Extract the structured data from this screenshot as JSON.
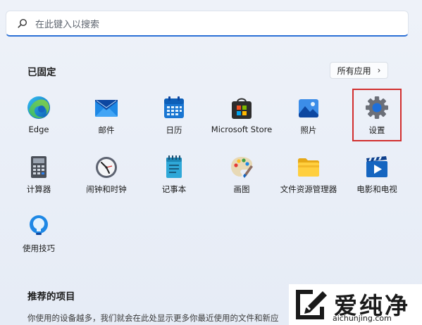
{
  "search": {
    "placeholder": "在此键入以搜索"
  },
  "pinned": {
    "title": "已固定",
    "all_apps_label": "所有应用",
    "apps": [
      {
        "label": "Edge",
        "icon": "edge-icon"
      },
      {
        "label": "邮件",
        "icon": "mail-icon"
      },
      {
        "label": "日历",
        "icon": "calendar-icon"
      },
      {
        "label": "Microsoft Store",
        "icon": "store-icon"
      },
      {
        "label": "照片",
        "icon": "photos-icon"
      },
      {
        "label": "设置",
        "icon": "settings-gear-icon"
      },
      {
        "label": "计算器",
        "icon": "calculator-icon"
      },
      {
        "label": "闹钟和时钟",
        "icon": "clock-icon"
      },
      {
        "label": "记事本",
        "icon": "notepad-icon"
      },
      {
        "label": "画图",
        "icon": "paint-icon"
      },
      {
        "label": "文件资源管理器",
        "icon": "folder-icon"
      },
      {
        "label": "电影和电视",
        "icon": "movies-icon"
      },
      {
        "label": "使用技巧",
        "icon": "tips-icon"
      }
    ]
  },
  "recommended": {
    "title": "推荐的项目",
    "text": "你使用的设备越多，我们就会在此处显示更多你最近使用的文件和新应"
  },
  "watermark": {
    "brand": "爱纯净",
    "url": "aichunjing.com"
  },
  "colors": {
    "accent": "#2b6fd6",
    "highlight_box": "#d22e2e"
  }
}
